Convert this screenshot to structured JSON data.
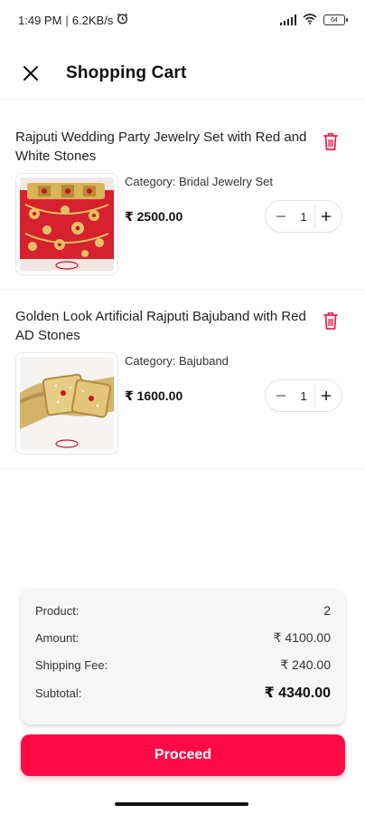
{
  "status_bar": {
    "time": "1:49 PM",
    "speed": "6.2KB/s",
    "battery": "64"
  },
  "header": {
    "title": "Shopping Cart"
  },
  "cart": {
    "items": [
      {
        "title": "Rajputi Wedding Party Jewelry Set with Red and White Stones",
        "category": "Category: Bridal Jewelry Set",
        "price": "₹ 2500.00",
        "quantity": "1"
      },
      {
        "title": "Golden Look Artificial Rajputi Bajuband with Red AD Stones",
        "category": "Category: Bajuband",
        "price": "₹ 1600.00",
        "quantity": "1"
      }
    ]
  },
  "summary": {
    "product_label": "Product:",
    "product_value": "2",
    "amount_label": "Amount:",
    "amount_value": "₹ 4100.00",
    "shipping_label": "Shipping Fee:",
    "shipping_value": "₹ 240.00",
    "subtotal_label": "Subtotal:",
    "subtotal_value": "₹ 4340.00"
  },
  "actions": {
    "proceed_label": "Proceed"
  },
  "colors": {
    "accent": "#ff0a45",
    "delete_icon": "#e8234f"
  },
  "icons": [
    "close-icon",
    "delete-icon",
    "minus-icon",
    "plus-icon",
    "alarm-icon",
    "signal-icon",
    "wifi-icon",
    "battery-icon"
  ]
}
